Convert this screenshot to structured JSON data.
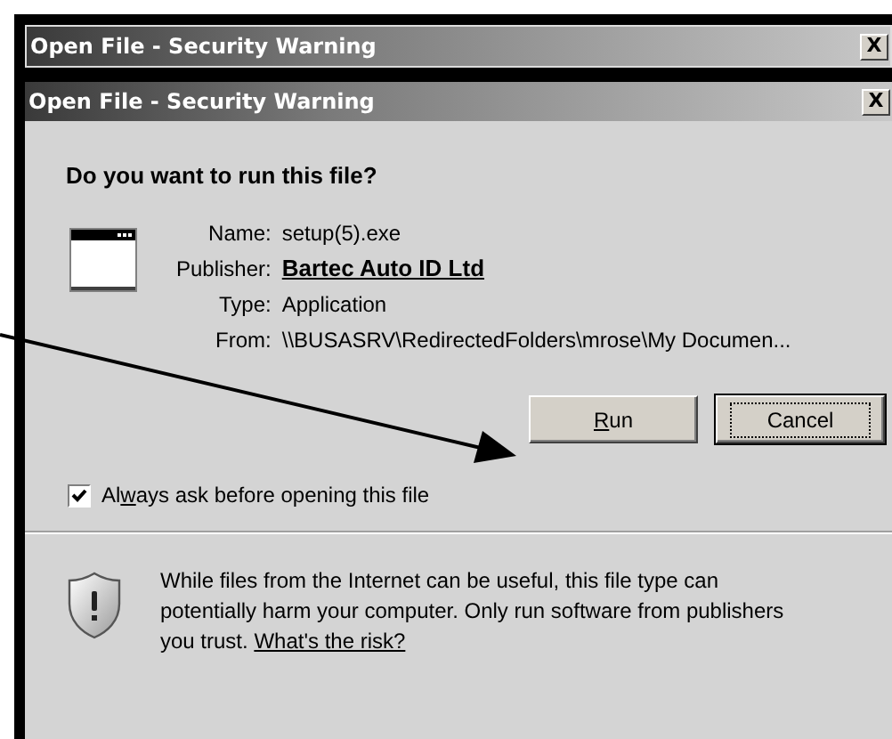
{
  "background_window": {
    "title": "Open File - Security Warning",
    "close": "X"
  },
  "dialog": {
    "title": "Open File - Security Warning",
    "close": "X",
    "question": "Do you want to run this file?",
    "details": [
      {
        "label": "Name:",
        "value": "setup(5).exe",
        "kind": "plain"
      },
      {
        "label": "Publisher:",
        "value": "Bartec Auto ID Ltd",
        "kind": "link"
      },
      {
        "label": "Type:",
        "value": "Application",
        "kind": "plain"
      },
      {
        "label": "From:",
        "value": "\\\\BUSASRV\\RedirectedFolders\\mrose\\My Documen...",
        "kind": "plain"
      }
    ],
    "buttons": [
      {
        "key": "R",
        "after": "un",
        "focused": false
      },
      {
        "after": "Cancel",
        "focused": true
      }
    ],
    "checkbox": {
      "before": "Al",
      "key": "w",
      "after": "ays ask before opening this file",
      "checked": true
    },
    "warning": {
      "text": "While files from the Internet can be useful, this file type can potentially harm your computer. Only run software from publishers you trust.",
      "link": "What's the risk?"
    }
  }
}
